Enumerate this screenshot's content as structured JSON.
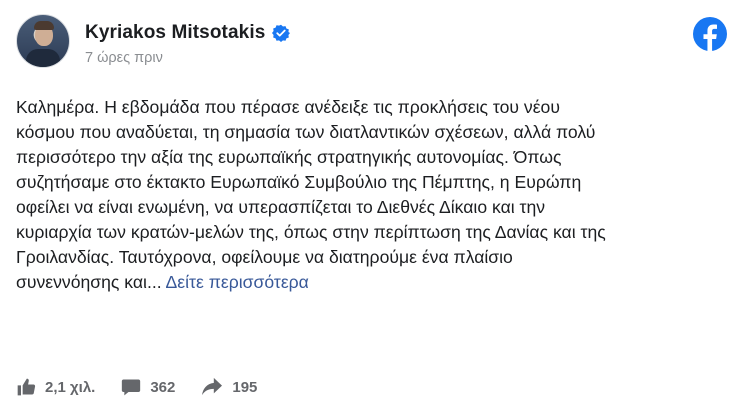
{
  "post": {
    "author": "Kyriakos Mitsotakis",
    "timestamp": "7 ώρες πριν",
    "verified": true,
    "text": "Καλημέρα. Η εβδομάδα που πέρασε ανέδειξε τις προκλήσεις του νέου\nκόσμου που αναδύεται, τη σημασία των διατλαντικών σχέσεων, αλλά πολύ\nπερισσότερο την αξία της ευρωπαϊκής στρατηγικής αυτονομίας. Όπως\nσυζητήσαμε στο έκτακτο Ευρωπαϊκό Συμβούλιο της Πέμπτης, η Ευρώπη\nοφείλει να είναι ενωμένη, να υπερασπίζεται το Διεθνές Δίκαιο και την\nκυριαρχία των κρατών-μελών της, όπως στην περίπτωση της Δανίας και της\nΓροιλανδίας. Ταυτόχρονα, οφείλουμε να διατηρούμε ένα πλαίσιο\nσυνεννόησης και... ",
    "see_more": "Δείτε περισσότερα"
  },
  "stats": {
    "likes": "2,1 χιλ.",
    "comments": "362",
    "shares": "195"
  },
  "icons": {
    "verified": "verified-badge-icon",
    "platform": "facebook-logo-icon",
    "like": "thumbs-up-icon",
    "comment": "comment-bubble-icon",
    "share": "share-arrow-icon"
  },
  "colors": {
    "facebook_blue": "#1877f2",
    "link": "#385898",
    "muted": "#65676b"
  }
}
